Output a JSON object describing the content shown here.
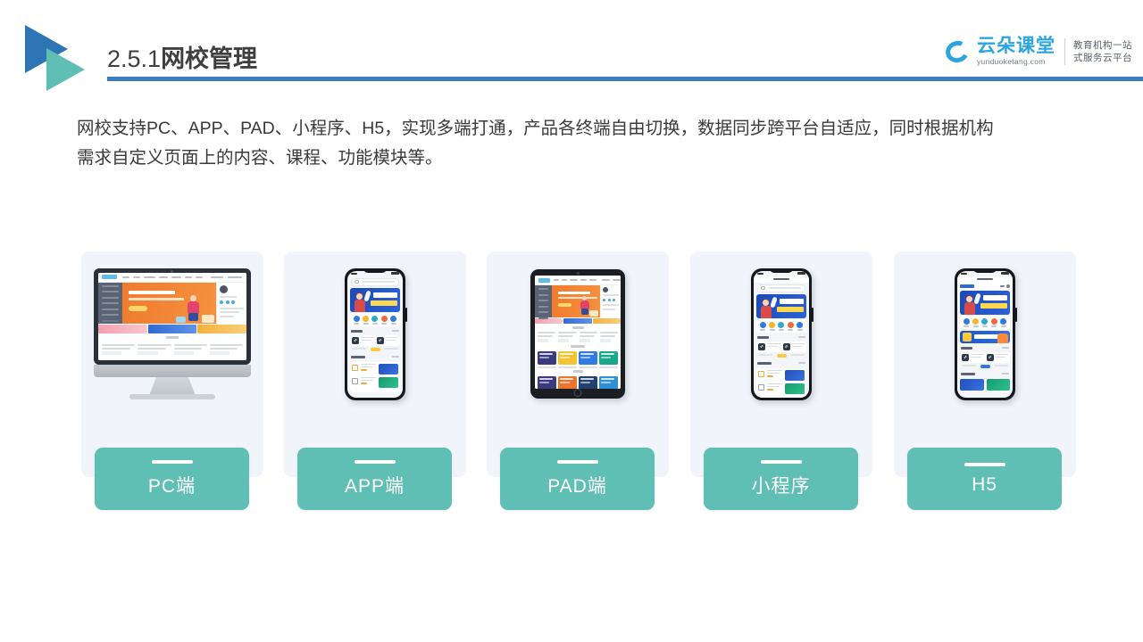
{
  "header": {
    "title_number": "2.5.1",
    "title_text": "网校管理",
    "logo_mark": "double-triangle-logo",
    "brand": {
      "name": "云朵课堂",
      "url": "yunduoketang.com",
      "tagline_line1": "教育机构一站",
      "tagline_line2": "式服务云平台"
    },
    "rule_color": "#3A7CBE"
  },
  "body": {
    "paragraph_line1": "网校支持PC、APP、PAD、小程序、H5，实现多端打通，产品各终端自由切换，数据同步跨平台自适应，同时根据机构",
    "paragraph_line2": "需求自定义页面上的内容、课程、功能模块等。"
  },
  "cards": [
    {
      "id": "pc",
      "label": "PC端",
      "device": "desktop-monitor"
    },
    {
      "id": "app",
      "label": "APP端",
      "device": "smartphone"
    },
    {
      "id": "pad",
      "label": "PAD端",
      "device": "tablet"
    },
    {
      "id": "miniapp",
      "label": "小程序",
      "device": "smartphone"
    },
    {
      "id": "h5",
      "label": "H5",
      "device": "smartphone"
    }
  ],
  "colors": {
    "accent_teal": "#5FBFB5",
    "accent_blue": "#3A7CBE",
    "logo_blue": "#2E75B6",
    "brand_cyan": "#2BA5E0",
    "card_bg": "#F1F4FA",
    "text_dark": "#3A3A3A",
    "banner_orange": "#F07B2E",
    "banner_blue": "#1A49B8"
  }
}
